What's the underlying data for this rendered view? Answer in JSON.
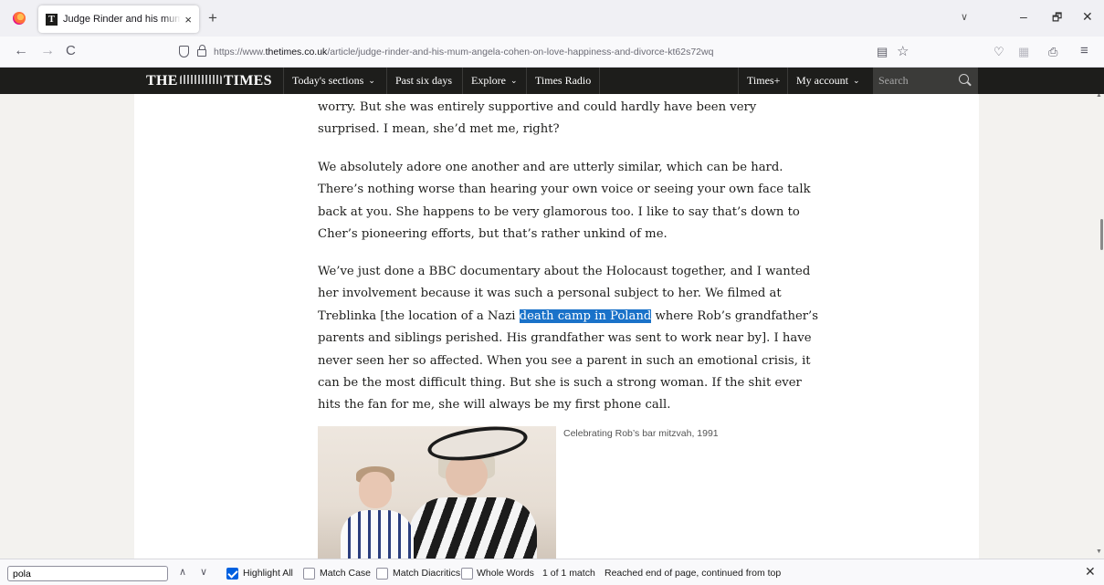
{
  "browser": {
    "tab": {
      "favicon": "T",
      "title": "Judge Rinder and his mum Angela Cohen on love, happiness and divorce",
      "close": "×"
    },
    "new_tab": "+",
    "tab_list": "∨",
    "window": {
      "minimize": "–",
      "restore": "🗗",
      "close": "✕"
    },
    "nav": {
      "back": "←",
      "forward": "→",
      "reload": "C"
    },
    "url_prefix": "https://www.",
    "url_domain": "thetimes.co.uk",
    "url_path": "/article/judge-rinder-and-his-mum-angela-cohen-on-love-happiness-and-divorce-kt62s72wq",
    "toolbar_icons": {
      "reader": "▤",
      "bookmark": "☆",
      "pocket": "♡",
      "ext": "▦",
      "share": "⎙",
      "menu": "≡"
    }
  },
  "site": {
    "logo_left": "THE",
    "logo_right": "TIMES",
    "nav": [
      {
        "label": "Today's sections",
        "caret": "⌄"
      },
      {
        "label": "Past six days"
      },
      {
        "label": "Explore",
        "caret": "⌄"
      },
      {
        "label": "Times Radio"
      }
    ],
    "times_plus": "Times+",
    "my_account": "My account",
    "search_placeholder": "Search"
  },
  "article": {
    "p1": [
      "worry. But she was entirely supportive and could hardly have been very",
      "surprised. I mean, she’d met me, right?"
    ],
    "p2": [
      "We absolutely adore one another and are utterly similar, which can be hard.",
      "There’s nothing worse than hearing your own voice or seeing your own face talk",
      "back at you. She happens to be very glamorous too. I like to say that’s down to",
      "Cher’s pioneering efforts, but that’s rather unkind of me."
    ],
    "p3": [
      "We’ve just done a BBC documentary about the Holocaust together, and I wanted",
      "her involvement because it was such a personal subject to her. We filmed at"
    ],
    "p3_hl_before": "Treblinka [the location of a Nazi ",
    "p3_hl": "death camp in Poland",
    "p3_hl_after": " where Rob’s grandfather’s",
    "p3_rest": [
      "parents and siblings perished. His grandfather was sent to work near by]. I have",
      "never seen her so affected. When you see a parent in such an emotional crisis, it",
      "can be the most difficult thing. But she is such a strong woman. If the shit ever",
      "hits the fan for me, she will always be my first phone call."
    ],
    "caption": "Celebrating Rob’s bar mitzvah, 1991"
  },
  "findbar": {
    "query": "pola",
    "prev": "∧",
    "next": "∨",
    "highlight_all": "Highlight All",
    "highlight_all_checked": true,
    "match_case": "Match Case",
    "match_diacritics": "Match Diacritics",
    "whole_words": "Whole Words",
    "result": "1 of 1 match",
    "status": "Reached end of page, continued from top",
    "close": "✕"
  }
}
